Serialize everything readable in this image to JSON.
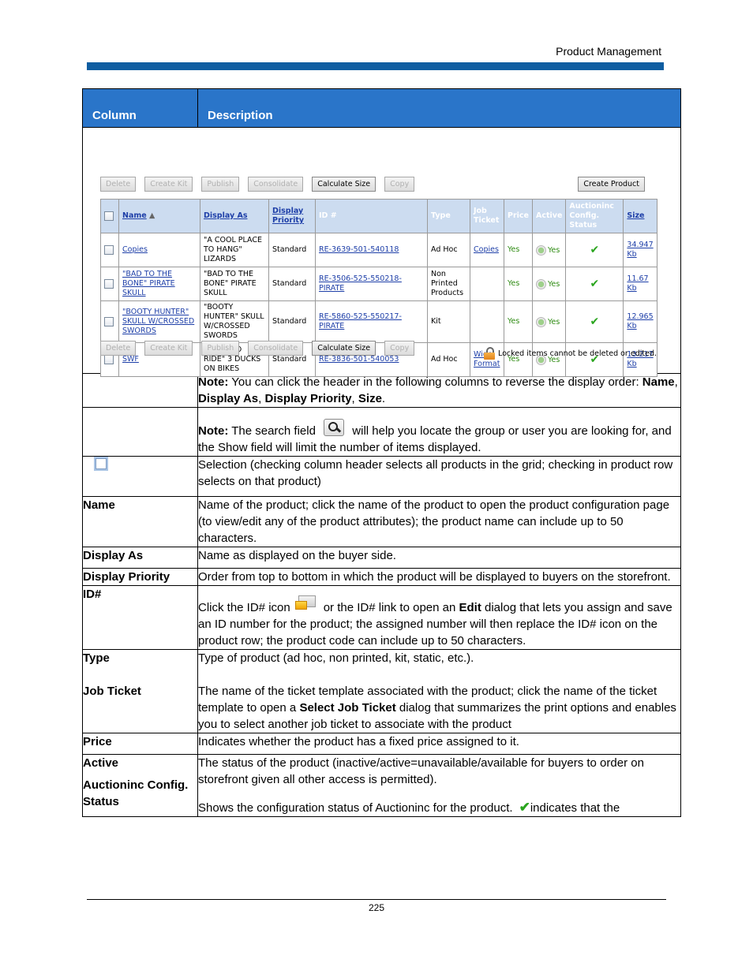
{
  "running_head": "Product Management",
  "page_number": "225",
  "table_header": {
    "column": "Column",
    "description": "Description"
  },
  "screenshot": {
    "top_buttons": [
      {
        "label": "Delete",
        "enabled": false
      },
      {
        "label": "Create Kit",
        "enabled": false
      },
      {
        "label": "Publish",
        "enabled": false
      },
      {
        "label": "Consolidate",
        "enabled": false
      },
      {
        "label": "Calculate Size",
        "enabled": true
      },
      {
        "label": "Copy",
        "enabled": false
      }
    ],
    "create_product": "Create Product",
    "grid_headers": {
      "name": "Name",
      "sort_indicator": "▲",
      "display_as": "Display As",
      "display_priority": "Display Priority",
      "id": "ID #",
      "type": "Type",
      "job_ticket": "Job Ticket",
      "price": "Price",
      "active": "Active",
      "auctioninc": "Auctioninc Config. Status",
      "size": "Size"
    },
    "rows": [
      {
        "name": "Copies",
        "display_as": "\"A COOL PLACE TO HANG\" LIZARDS",
        "priority": "Standard",
        "id": "RE-3639-501-540118",
        "type": "Ad Hoc",
        "job_ticket": "Copies",
        "price": "Yes",
        "active": "Yes",
        "auction": "✔",
        "size": "34.947 Kb"
      },
      {
        "name": "\"BAD TO THE BONE\" PIRATE SKULL",
        "display_as": "\"BAD TO THE BONE\" PIRATE SKULL",
        "priority": "Standard",
        "id": "RE-3506-525-550218-PIRATE",
        "type": "Non Printed Products",
        "job_ticket": "",
        "price": "Yes",
        "active": "Yes",
        "auction": "✔",
        "size": "11.67 Kb"
      },
      {
        "name": "\"BOOTY HUNTER\" SKULL W/CROSSED SWORDS",
        "display_as": "\"BOOTY HUNTER\" SKULL W/CROSSED SWORDS",
        "priority": "Standard",
        "id": "RE-5860-525-550217-PIRATE",
        "type": "Kit",
        "job_ticket": "",
        "price": "Yes",
        "active": "Yes",
        "auction": "✔",
        "size": "12.965 Kb"
      },
      {
        "name": "SWF",
        "display_as": "\"BORN TO RIDE\" 3 DUCKS ON BIKES",
        "priority": "Standard",
        "id": "RE-3836-501-540053",
        "type": "Ad Hoc",
        "job_ticket": "Wide Format",
        "price": "Yes",
        "active": "Yes",
        "auction": "✔",
        "size": "13.217 Kb"
      }
    ],
    "locked_note": "Locked items cannot be deleted or edited."
  },
  "notes": {
    "sort_note_label": "Note:",
    "sort_note_text": " You can click the header in the following columns to reverse the display order: ",
    "sort_cols": [
      "Name",
      "Display As",
      "Display Priority",
      "Size"
    ],
    "search_note_label": "Note:",
    "search_note_pre": " The search field ",
    "search_note_post": " will help you locate the group or user you are looking for, and the Show field will limit the number of items displayed."
  },
  "rows": {
    "selection": "Selection (checking column header selects all products in the grid; checking in product row selects on that product)",
    "name_label": "Name",
    "name_desc": "Name of the product; click the name of the product to open the product configuration page (to view/edit any of the product attributes); the product name can include up to 50 characters.",
    "display_as_label": "Display As",
    "display_as_desc": "Name as displayed on the buyer side.",
    "display_priority_label": "Display Priority",
    "display_priority_desc": "Order from top to bottom in which the product will be displayed to buyers on the storefront.",
    "id_label": "ID#",
    "id_pre": "Click the ID# icon",
    "id_mid": "or the ID# link to open an ",
    "id_bold": "Edit",
    "id_post": " dialog that lets you assign and save an ID number for the product; the assigned number will then replace the ID# icon on the product row; the product code can include up to 50 characters.",
    "type_label": "Type",
    "type_desc": "Type of product (ad hoc, non printed, kit, static, etc.).",
    "job_ticket_label": "Job Ticket",
    "job_ticket_pre": "The name of the ticket template associated with the product; click the name of the ticket template to open a ",
    "job_ticket_bold": "Select Job Ticket",
    "job_ticket_post": " dialog that summarizes the print options and enables you to select another job ticket to associate with the product",
    "price_label": "Price",
    "price_desc": "Indicates whether the product has a fixed price assigned to it.",
    "active_label": "Active",
    "active_desc": "The status of the product (inactive/active=unavailable/available for buyers to order on storefront given all other access is permitted).",
    "auction_label": "Auctioninc Config. Status",
    "auction_pre": "Shows the configuration status of Auctioninc for the product.",
    "auction_post": "indicates that the"
  }
}
